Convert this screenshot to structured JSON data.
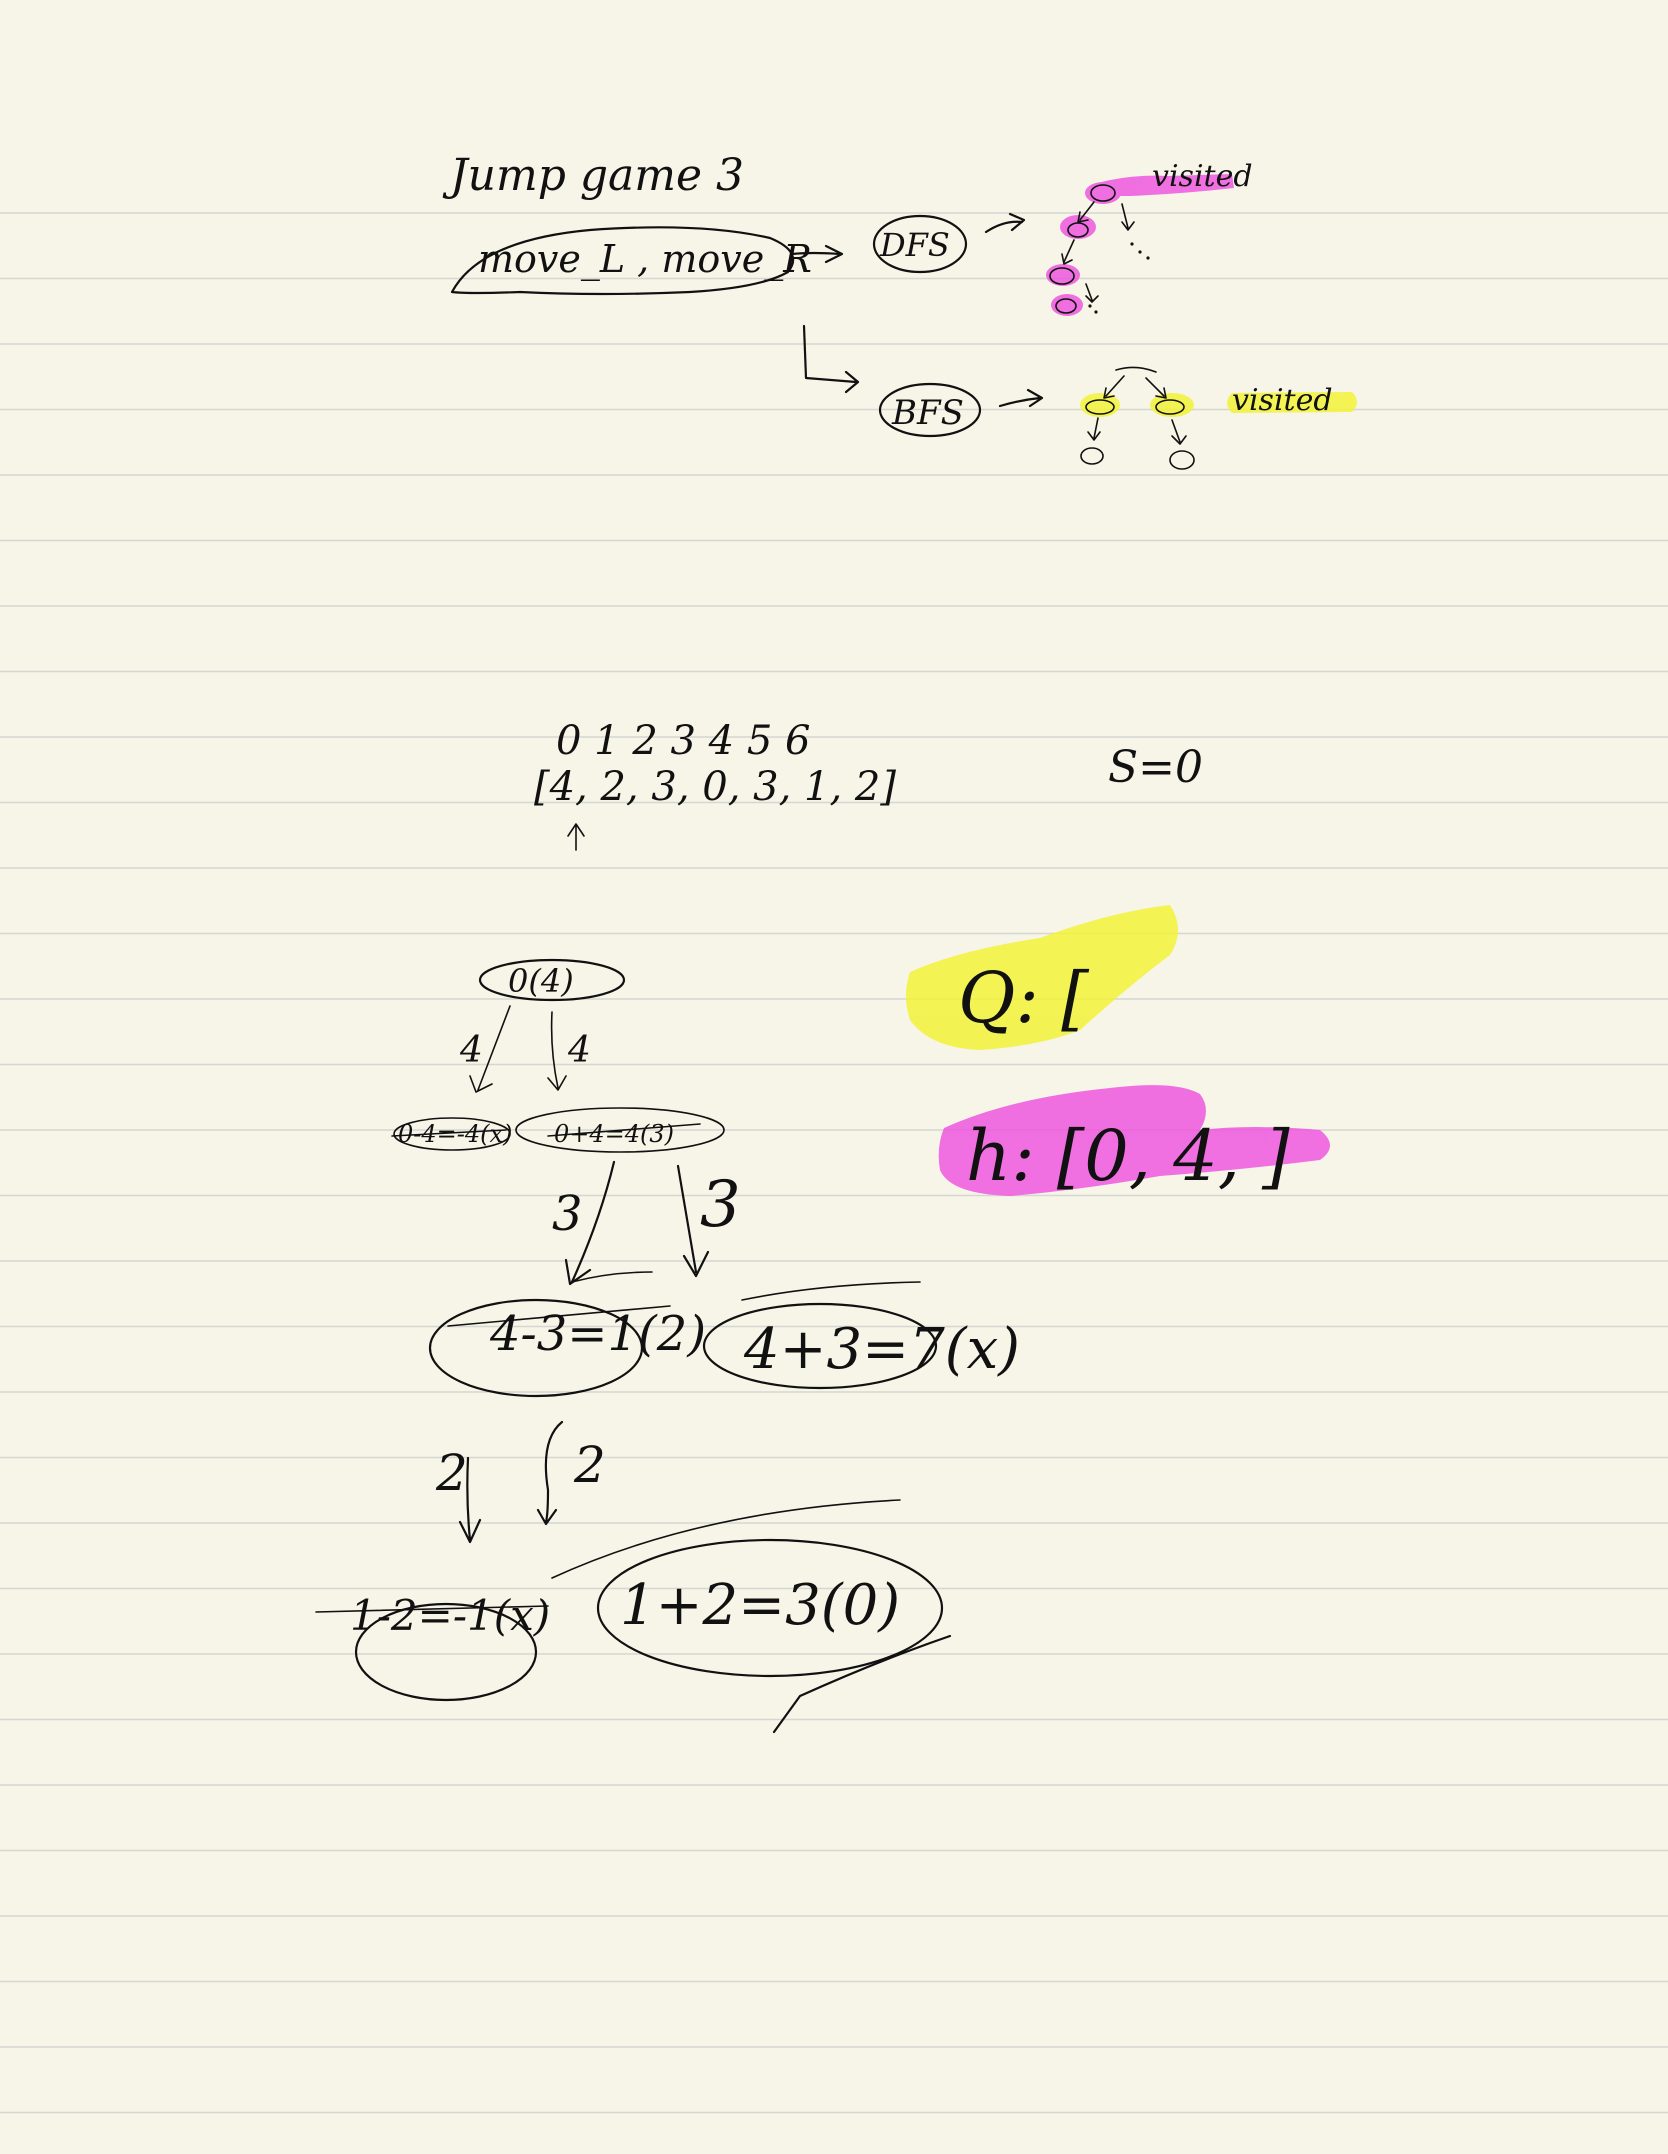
{
  "notes": {
    "title": "Jump game 3",
    "moves": "move_L , move_R",
    "dfs": "DFS",
    "bfs": "BFS",
    "visited_dfs": "visited",
    "visited_bfs": "visited",
    "indices": "0  1  2  3  4  5  6",
    "array": "[4, 2, 3, 0, 3, 1, 2]",
    "start": "S=0",
    "queue": "Q: [",
    "visited_list": "h: [0, 4, ]",
    "tree": {
      "root": "0(4)",
      "branch_l": "4",
      "branch_r": "4",
      "n1": "0-4=-4(x)",
      "n2": "0+4=4(3)",
      "branch_3l": "3",
      "branch_3r": "3",
      "n3": "4-3=1(2)",
      "n4": "4+3=7(x)",
      "branch_2l": "2",
      "branch_2r": "2",
      "n5": "1-2=-1(x)",
      "n6": "1+2=3(0)"
    }
  },
  "colors": {
    "paper": "#f7f5e8",
    "rule": "#d6d6d2",
    "ink": "#111111",
    "highlight_pink": "#ee58e0",
    "highlight_yellow": "#f2f23a"
  }
}
